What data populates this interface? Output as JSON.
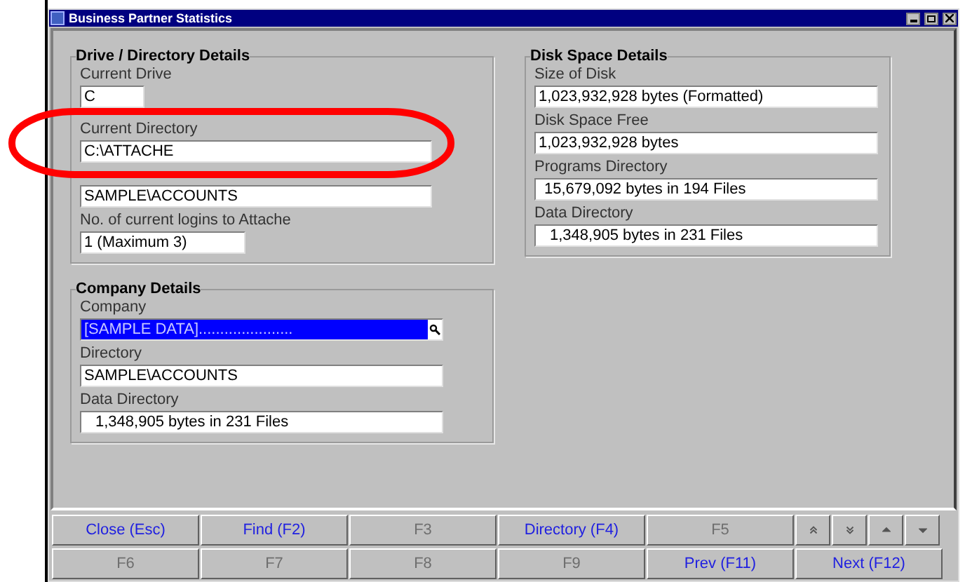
{
  "window": {
    "title": "Business Partner Statistics"
  },
  "groups": [
    {
      "title": "Drive / Directory Details",
      "fields": [
        {
          "label": "Current Drive",
          "value": "C"
        },
        {
          "label": "Current Directory",
          "value": "C:\\ATTACHE"
        },
        {
          "value": "SAMPLE\\ACCOUNTS"
        },
        {
          "label": "No. of current logins to Attache",
          "value": "1 (Maximum 3)"
        }
      ]
    },
    {
      "title": "Disk Space Details",
      "fields": [
        {
          "label": "Size of Disk",
          "value": "1,023,932,928 bytes (Formatted)"
        },
        {
          "label": "Disk Space Free",
          "value": "1,023,932,928 bytes"
        },
        {
          "label": "Programs Directory",
          "value": "15,679,092 bytes in 194 Files"
        },
        {
          "label": "Data Directory",
          "value": "1,348,905 bytes in 231 Files"
        }
      ]
    },
    {
      "title": "Company Details",
      "fields": [
        {
          "label": "Company",
          "value": "[SAMPLE DATA]......................",
          "kind": "lookup",
          "highlighted": true
        },
        {
          "label": "Directory",
          "value": "SAMPLE\\ACCOUNTS"
        },
        {
          "label": "Data Directory",
          "value": "1,348,905 bytes in 231 Files"
        }
      ]
    }
  ],
  "buttons": [
    {
      "kind": "text",
      "label": "Close (Esc)",
      "disabled": false
    },
    {
      "kind": "text",
      "label": "Find (F2)",
      "disabled": false
    },
    {
      "kind": "text",
      "label": "F3",
      "disabled": true
    },
    {
      "kind": "text",
      "label": "Directory (F4)",
      "disabled": false
    },
    {
      "kind": "text",
      "label": "F5",
      "disabled": true
    },
    {
      "kind": "icon"
    },
    {
      "kind": "icon"
    },
    {
      "kind": "icon"
    },
    {
      "kind": "icon"
    },
    {
      "kind": "text",
      "label": "F6",
      "disabled": true
    },
    {
      "kind": "text",
      "label": "F7",
      "disabled": true
    },
    {
      "kind": "text",
      "label": "F8",
      "disabled": true
    },
    {
      "kind": "text",
      "label": "F9",
      "disabled": true
    },
    {
      "kind": "text",
      "label": "Prev (F11)",
      "disabled": false
    },
    {
      "kind": "text",
      "label": "Next (F12)",
      "disabled": false
    }
  ]
}
